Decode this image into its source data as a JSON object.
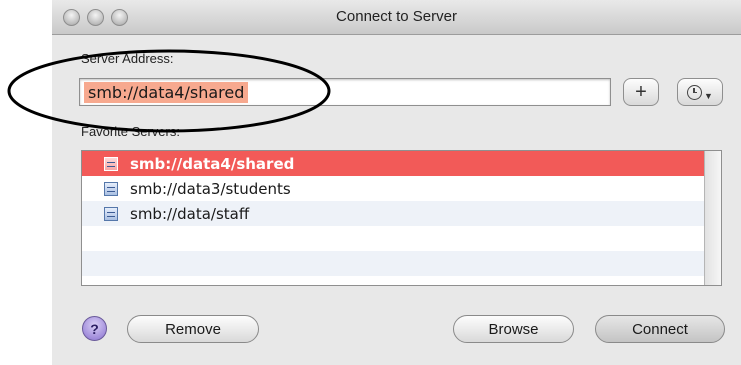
{
  "window": {
    "title": "Connect to Server"
  },
  "server_address": {
    "label": "Server Address:",
    "value": "smb://data4/shared"
  },
  "buttons": {
    "add_icon": "plus-icon",
    "recent_icon": "clock-icon",
    "remove": "Remove",
    "browse": "Browse",
    "connect": "Connect",
    "help": "?"
  },
  "favorites": {
    "label": "Favorite Servers:",
    "items": [
      {
        "label": "smb://data4/shared",
        "selected": true
      },
      {
        "label": "smb://data3/students",
        "selected": false
      },
      {
        "label": "smb://data/staff",
        "selected": false
      }
    ]
  },
  "colors": {
    "selection": "#f25a58",
    "field_highlight": "#f7a98f",
    "annotation_ellipse": "#000000"
  }
}
